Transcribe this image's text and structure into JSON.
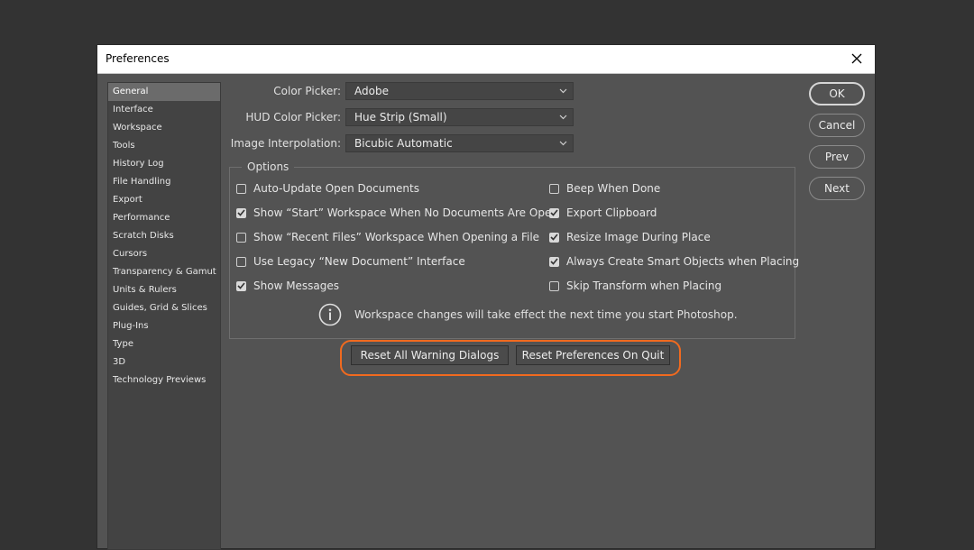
{
  "dialog": {
    "title": "Preferences"
  },
  "sidebar": {
    "items": [
      {
        "label": "General",
        "active": true
      },
      {
        "label": "Interface"
      },
      {
        "label": "Workspace"
      },
      {
        "label": "Tools"
      },
      {
        "label": "History Log"
      },
      {
        "label": "File Handling"
      },
      {
        "label": "Export"
      },
      {
        "label": "Performance"
      },
      {
        "label": "Scratch Disks"
      },
      {
        "label": "Cursors"
      },
      {
        "label": "Transparency & Gamut"
      },
      {
        "label": "Units & Rulers"
      },
      {
        "label": "Guides, Grid & Slices"
      },
      {
        "label": "Plug-Ins"
      },
      {
        "label": "Type"
      },
      {
        "label": "3D"
      },
      {
        "label": "Technology Previews"
      }
    ]
  },
  "fields": {
    "color_picker": {
      "label": "Color Picker:",
      "value": "Adobe"
    },
    "hud_color_picker": {
      "label": "HUD Color Picker:",
      "value": "Hue Strip (Small)"
    },
    "image_interpolation": {
      "label": "Image Interpolation:",
      "value": "Bicubic Automatic"
    }
  },
  "options": {
    "legend": "Options",
    "left": [
      {
        "label": "Auto-Update Open Documents",
        "checked": false
      },
      {
        "label": "Show “Start” Workspace When No Documents Are Open",
        "checked": true
      },
      {
        "label": "Show “Recent Files” Workspace When Opening a File",
        "checked": false
      },
      {
        "label": "Use Legacy “New Document” Interface",
        "checked": false
      },
      {
        "label": "Show Messages",
        "checked": true
      }
    ],
    "right": [
      {
        "label": "Beep When Done",
        "checked": false
      },
      {
        "label": "Export Clipboard",
        "checked": true
      },
      {
        "label": "Resize Image During Place",
        "checked": true
      },
      {
        "label": "Always Create Smart Objects when Placing",
        "checked": true
      },
      {
        "label": "Skip Transform when Placing",
        "checked": false
      }
    ],
    "info": "Workspace changes will take effect the next time you start Photoshop."
  },
  "reset": {
    "warnings_label": "Reset All Warning Dialogs",
    "prefs_label": "Reset Preferences On Quit",
    "highlight_color": "#f16a1f"
  },
  "actions": {
    "ok": "OK",
    "cancel": "Cancel",
    "prev": "Prev",
    "next": "Next"
  }
}
